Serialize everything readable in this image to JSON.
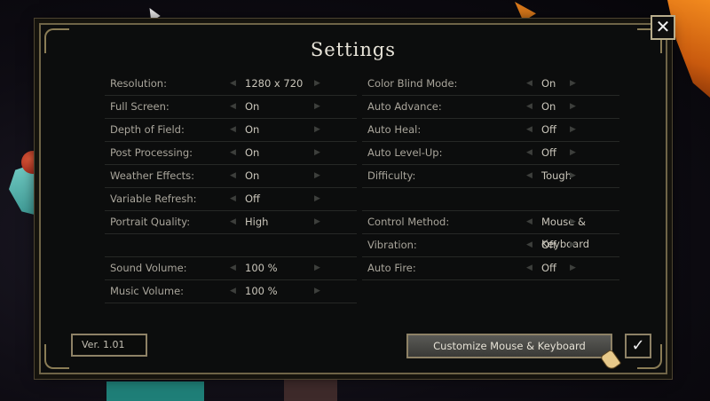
{
  "dialog": {
    "title": "Settings",
    "close_icon": "close-icon",
    "version": "Ver. 1.01",
    "customize_label": "Customize Mouse & Keyboard",
    "confirm_icon": "checkmark-icon"
  },
  "left_settings": [
    {
      "label": "Resolution:",
      "value": "1280 x 720"
    },
    {
      "label": "Full Screen:",
      "value": "On"
    },
    {
      "label": "Depth of Field:",
      "value": "On"
    },
    {
      "label": "Post Processing:",
      "value": "On"
    },
    {
      "label": "Weather Effects:",
      "value": "On"
    },
    {
      "label": "Variable Refresh:",
      "value": "Off"
    },
    {
      "label": "Portrait Quality:",
      "value": "High"
    },
    {
      "label": "",
      "value": ""
    },
    {
      "label": "Sound Volume:",
      "value": "100 %"
    },
    {
      "label": "Music Volume:",
      "value": "100 %"
    }
  ],
  "right_settings": [
    {
      "label": "Color Blind Mode:",
      "value": "On"
    },
    {
      "label": "Auto Advance:",
      "value": "On"
    },
    {
      "label": "Auto Heal:",
      "value": "Off"
    },
    {
      "label": "Auto Level-Up:",
      "value": "Off"
    },
    {
      "label": "Difficulty:",
      "value": "Tough"
    },
    {
      "label": "",
      "value": ""
    },
    {
      "label": "Control Method:",
      "value": "Mouse & Keyboard"
    },
    {
      "label": "Vibration:",
      "value": "Off"
    },
    {
      "label": "Auto Fire:",
      "value": "Off"
    }
  ],
  "colors": {
    "panel_bg": "#0c0d0d",
    "frame": "#8e8266",
    "text": "#c9c5ba",
    "button_highlight": "#4a4a46"
  }
}
